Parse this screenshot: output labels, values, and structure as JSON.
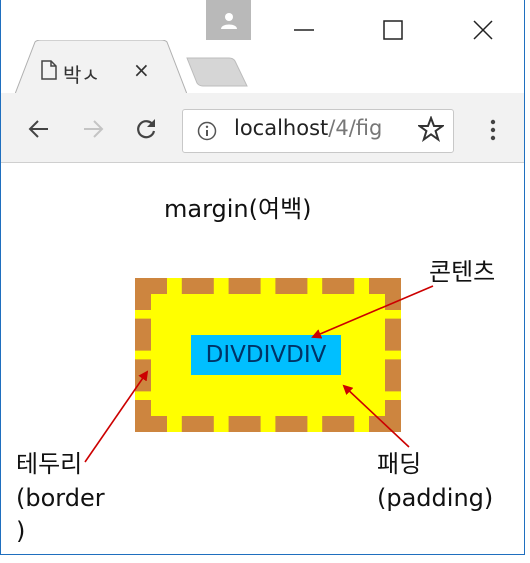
{
  "browser": {
    "tab_title": "박ㅅ",
    "tab_close": "×",
    "url_host": "localhost",
    "url_path": "/4/fig"
  },
  "page": {
    "margin_label": "margin(여백)",
    "div_text": "DIVDIVDIV",
    "labels": {
      "content": "콘텐츠",
      "border_line1": "테두리",
      "border_line2": "(border",
      "border_line3": ")",
      "padding_line1": "패딩",
      "padding_line2": "(padding)"
    }
  },
  "colors": {
    "border": "#cd853f",
    "padding": "#ffff00",
    "content": "#00bfff",
    "arrow": "#cc0000"
  }
}
